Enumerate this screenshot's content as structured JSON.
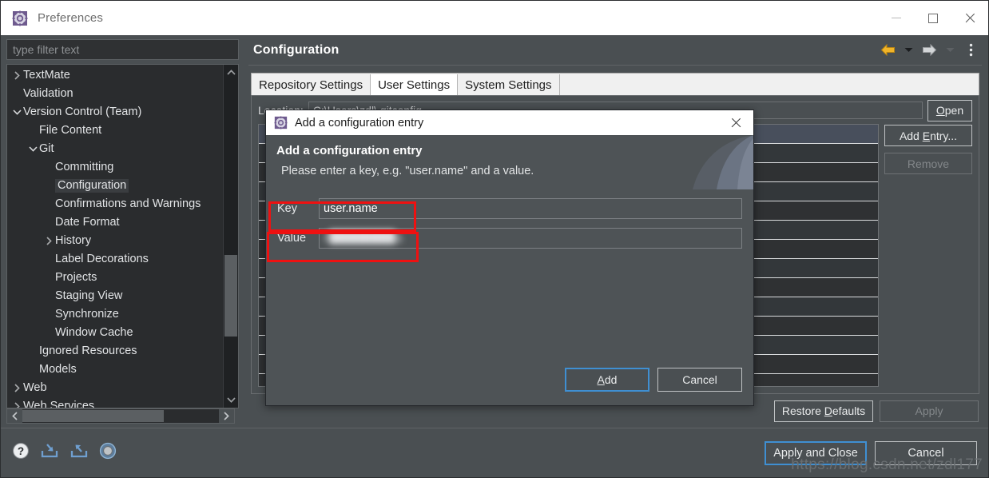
{
  "window": {
    "title": "Preferences",
    "icon": "preferences-gear-icon",
    "controls": {
      "minimize": "—",
      "maximize": "□",
      "close": "✕"
    }
  },
  "sidebar": {
    "filter_placeholder": "type filter text",
    "tree": [
      {
        "label": "TextMate",
        "depth": 0,
        "arrow": "right",
        "selected": false
      },
      {
        "label": "Validation",
        "depth": 0,
        "arrow": "none",
        "selected": false
      },
      {
        "label": "Version Control (Team)",
        "depth": 0,
        "arrow": "down",
        "selected": false
      },
      {
        "label": "File Content",
        "depth": 1,
        "arrow": "none",
        "selected": false
      },
      {
        "label": "Git",
        "depth": 1,
        "arrow": "down",
        "selected": false
      },
      {
        "label": "Committing",
        "depth": 2,
        "arrow": "none",
        "selected": false
      },
      {
        "label": "Configuration",
        "depth": 2,
        "arrow": "none",
        "selected": true
      },
      {
        "label": "Confirmations and Warnings",
        "depth": 2,
        "arrow": "none",
        "selected": false
      },
      {
        "label": "Date Format",
        "depth": 2,
        "arrow": "none",
        "selected": false
      },
      {
        "label": "History",
        "depth": 2,
        "arrow": "right",
        "selected": false
      },
      {
        "label": "Label Decorations",
        "depth": 2,
        "arrow": "none",
        "selected": false
      },
      {
        "label": "Projects",
        "depth": 2,
        "arrow": "none",
        "selected": false
      },
      {
        "label": "Staging View",
        "depth": 2,
        "arrow": "none",
        "selected": false
      },
      {
        "label": "Synchronize",
        "depth": 2,
        "arrow": "none",
        "selected": false
      },
      {
        "label": "Window Cache",
        "depth": 2,
        "arrow": "none",
        "selected": false
      },
      {
        "label": "Ignored Resources",
        "depth": 1,
        "arrow": "none",
        "selected": false
      },
      {
        "label": "Models",
        "depth": 1,
        "arrow": "none",
        "selected": false
      },
      {
        "label": "Web",
        "depth": 0,
        "arrow": "right",
        "selected": false
      },
      {
        "label": "Web Services",
        "depth": 0,
        "arrow": "right",
        "selected": false
      }
    ]
  },
  "page": {
    "title": "Configuration",
    "nav": {
      "back": "back-arrow",
      "back_menu": "back-dropdown",
      "forward": "forward-arrow",
      "forward_menu": "forward-dropdown",
      "menu": "view-menu"
    },
    "tabs": [
      {
        "label": "Repository Settings",
        "active": false
      },
      {
        "label": "User Settings",
        "active": true
      },
      {
        "label": "System Settings",
        "active": false
      }
    ],
    "location_label": "Location:",
    "location_value": "C:\\Users\\zdl\\.gitconfig",
    "open_button": "Open",
    "open_mnemonic": "O",
    "add_entry_button": "Add Entry...",
    "add_entry_mnemonic": "E",
    "remove_button": "Remove",
    "remove_disabled": true,
    "restore_defaults_button": "Restore Defaults",
    "restore_defaults_mnemonic": "D",
    "apply_button": "Apply",
    "apply_disabled": true
  },
  "footer": {
    "icons": [
      "help-icon",
      "import-icon",
      "export-icon",
      "target-icon"
    ],
    "apply_and_close_button": "Apply and Close",
    "cancel_button": "Cancel"
  },
  "dialog": {
    "titlebar_text": "Add a configuration entry",
    "titlebar_icon": "preferences-gear-icon",
    "close": "✕",
    "heading": "Add a configuration entry",
    "description": "Please enter a key, e.g. \"user.name\" and a value.",
    "key_label": "Key",
    "key_value": "user.name",
    "value_label": "Value",
    "value_value": "z████████g.",
    "add_button": "Add",
    "add_mnemonic": "A",
    "cancel_button": "Cancel"
  },
  "annotations": {
    "highlight_color": "#ee1111",
    "key_box": "red-highlight-key",
    "value_box": "red-highlight-value"
  },
  "watermark": {
    "text": "https://blog.csdn.net/zdl177"
  }
}
